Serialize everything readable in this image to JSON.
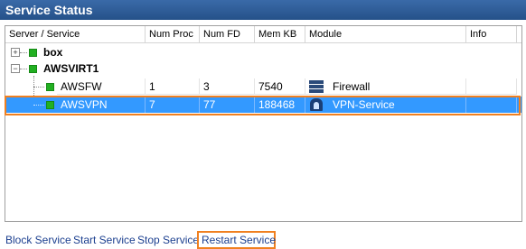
{
  "window": {
    "title": "Service Status"
  },
  "columns": [
    "Server / Service",
    "Num Proc",
    "Num FD",
    "Mem KB",
    "Module",
    "Info"
  ],
  "tree": {
    "box": {
      "label": "box"
    },
    "awsvirt1": {
      "label": "AWSVIRT1"
    }
  },
  "rows": [
    {
      "name": "AWSFW",
      "num_proc": "1",
      "num_fd": "3",
      "mem_kb": "7540",
      "module": "Firewall",
      "module_icon": "firewall-icon",
      "info": ""
    },
    {
      "name": "AWSVPN",
      "num_proc": "7",
      "num_fd": "77",
      "mem_kb": "188468",
      "module": "VPN-Service",
      "module_icon": "vpn-lock-icon",
      "info": ""
    }
  ],
  "selected_row": "AWSVPN",
  "actions": {
    "block": "Block Service",
    "start": "Start Service",
    "stop": "Stop Service",
    "restart": "Restart Service"
  },
  "colors": {
    "title_bar": "#255189",
    "selection": "#3399ff",
    "highlight": "#f08020",
    "link": "#1b3f8f",
    "status_green": "#22b022"
  }
}
